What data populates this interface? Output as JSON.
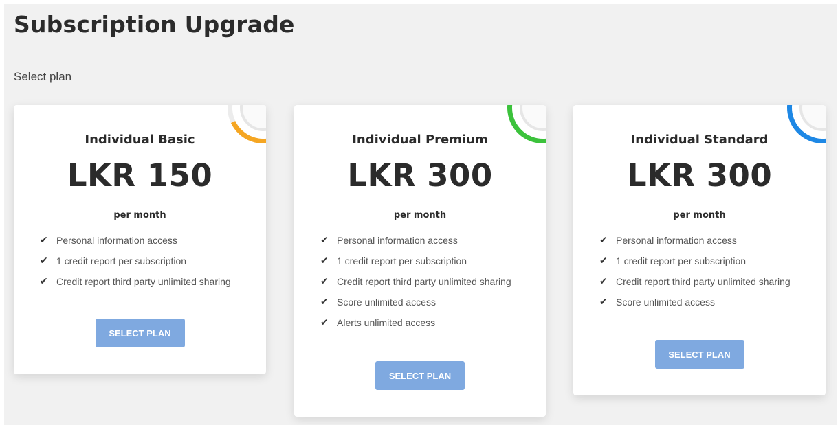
{
  "page": {
    "title": "Subscription Upgrade",
    "subtitle": "Select plan"
  },
  "colors": {
    "button": "#7fa9e0",
    "basic_accent": "#f5a623",
    "premium_accent": "#3cc23c",
    "standard_accent": "#1e88e5"
  },
  "check_icon": "✔",
  "plans": [
    {
      "name": "Individual Basic",
      "price": "LKR 150",
      "period": "per month",
      "features": [
        "Personal information access",
        "1 credit report per subscription",
        "Credit report third party unlimited sharing"
      ],
      "button_label": "SELECT PLAN"
    },
    {
      "name": "Individual Premium",
      "price": "LKR 300",
      "period": "per month",
      "features": [
        "Personal information access",
        "1 credit report per subscription",
        "Credit report third party unlimited sharing",
        "Score unlimited access",
        "Alerts unlimited access"
      ],
      "button_label": "SELECT PLAN"
    },
    {
      "name": "Individual Standard",
      "price": "LKR 300",
      "period": "per month",
      "features": [
        "Personal information access",
        "1 credit report per subscription",
        "Credit report third party unlimited sharing",
        "Score unlimited access"
      ],
      "button_label": "SELECT PLAN"
    }
  ]
}
